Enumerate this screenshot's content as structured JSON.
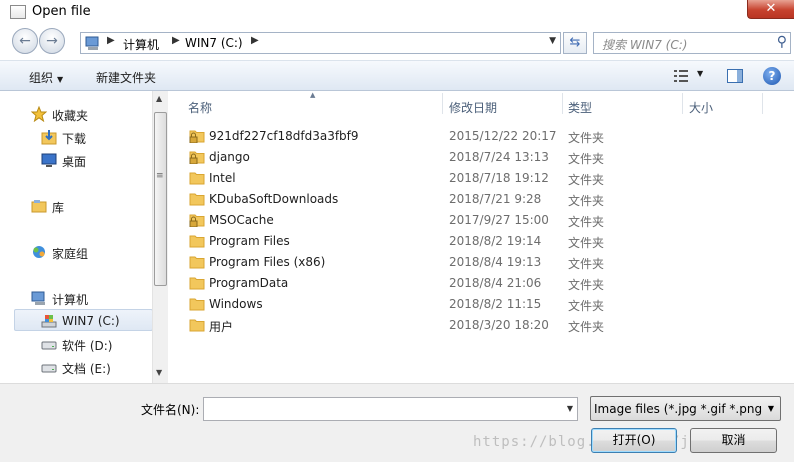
{
  "window": {
    "title": "Open file",
    "close_label": "✕"
  },
  "address": {
    "crumbs": [
      "计算机",
      "WIN7 (C:)"
    ],
    "search_placeholder": "搜索 WIN7 (C:)"
  },
  "toolbar": {
    "organize": "组织",
    "new_folder": "新建文件夹"
  },
  "nav": {
    "items": [
      {
        "label": "收藏夹",
        "icon": "star-icon"
      },
      {
        "label": "下载",
        "icon": "download-folder-icon"
      },
      {
        "label": "桌面",
        "icon": "desktop-icon"
      },
      {
        "label": "库",
        "icon": "library-icon"
      },
      {
        "label": "家庭组",
        "icon": "homegroup-icon"
      },
      {
        "label": "计算机",
        "icon": "computer-icon"
      },
      {
        "label": "WIN7 (C:)",
        "icon": "system-drive-icon"
      },
      {
        "label": "软件 (D:)",
        "icon": "drive-icon"
      },
      {
        "label": "文档 (E:)",
        "icon": "drive-icon"
      }
    ]
  },
  "columns": {
    "name": "名称",
    "date": "修改日期",
    "type": "类型",
    "size": "大小"
  },
  "files": [
    {
      "name": "921df227cf18dfd3a3fbf9",
      "date": "2015/12/22 20:17",
      "type": "文件夹",
      "locked": true
    },
    {
      "name": "django",
      "date": "2018/7/24 13:13",
      "type": "文件夹",
      "locked": true
    },
    {
      "name": "Intel",
      "date": "2018/7/18 19:12",
      "type": "文件夹",
      "locked": false
    },
    {
      "name": "KDubaSoftDownloads",
      "date": "2018/7/21 9:28",
      "type": "文件夹",
      "locked": false
    },
    {
      "name": "MSOCache",
      "date": "2017/9/27 15:00",
      "type": "文件夹",
      "locked": true
    },
    {
      "name": "Program Files",
      "date": "2018/8/2 19:14",
      "type": "文件夹",
      "locked": false
    },
    {
      "name": "Program Files (x86)",
      "date": "2018/8/4 19:13",
      "type": "文件夹",
      "locked": false
    },
    {
      "name": "ProgramData",
      "date": "2018/8/4 21:06",
      "type": "文件夹",
      "locked": false
    },
    {
      "name": "Windows",
      "date": "2018/8/2 11:15",
      "type": "文件夹",
      "locked": false
    },
    {
      "name": "用户",
      "date": "2018/3/20 18:20",
      "type": "文件夹",
      "locked": false
    }
  ],
  "bottom": {
    "filename_label": "文件名(N):",
    "filename_value": "",
    "filter": "Image files (*.jpg *.gif *.png",
    "open": "打开(O)",
    "cancel": "取消",
    "watermark": "https://blog.csdn.net/jiangxu666"
  },
  "colors": {
    "folder": "#f2c75c",
    "folder_dark": "#d9a632",
    "accent": "#3c7fb1"
  }
}
